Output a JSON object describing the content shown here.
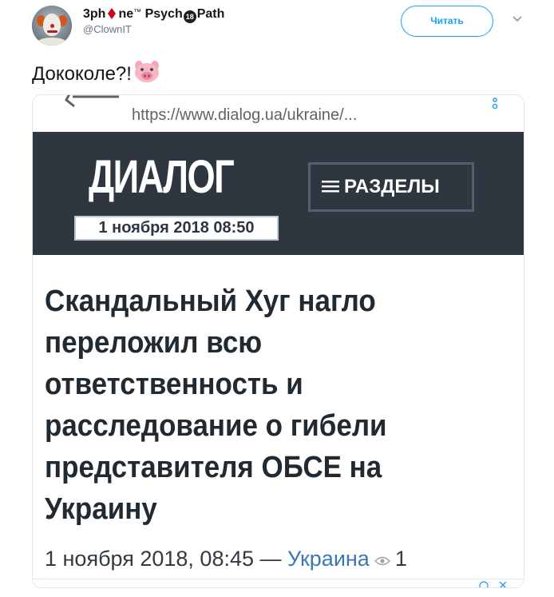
{
  "tweet": {
    "author": {
      "name_part1": "3ph",
      "name_part2": "ne",
      "name_tm": "™",
      "name_part3": "Psych",
      "name_badge": "18",
      "name_part4": "Path",
      "handle": "@ClownIT"
    },
    "follow_label": "Читать",
    "text": "Дококоле?!",
    "emoji": "pig-face-icon"
  },
  "card": {
    "url": "https://www.dialog.ua/ukraine/...",
    "site": {
      "logo": "ДИАЛОГ",
      "date_box": "1 ноября 2018 08:50",
      "sections_label": "РАЗДЕЛЫ"
    },
    "article": {
      "headline": "Скандальный Хуг нагло переложил всю ответственность и расследование о гибели представителя ОБСЕ на Украину",
      "date": "1 ноября 2018, 08:45",
      "separator": "—",
      "category": "Украина",
      "views": "1"
    }
  },
  "colors": {
    "header_bg": "#2e3740",
    "link_blue": "#1da1f2",
    "category_blue": "#3a78b5",
    "diamond_red": "#d0021b"
  }
}
